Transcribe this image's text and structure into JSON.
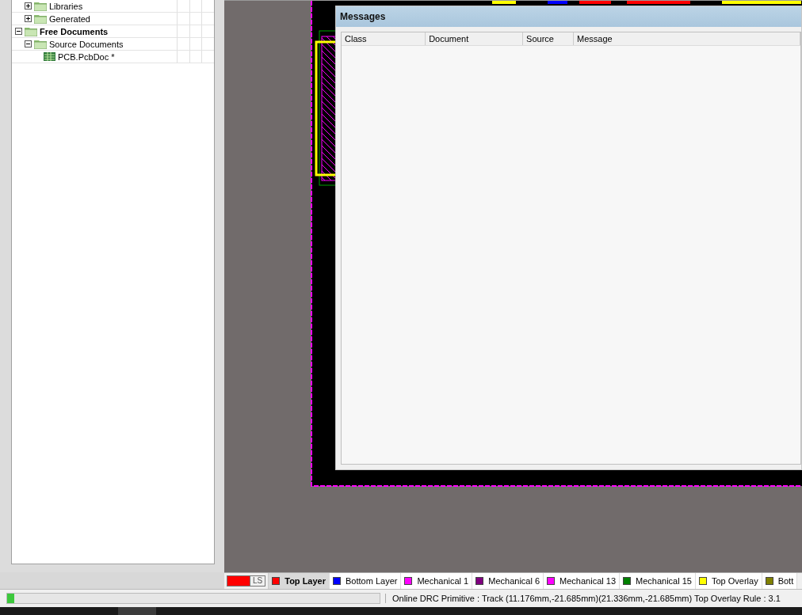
{
  "project_tree": {
    "items": [
      {
        "children": [
          {
            "label": "Libraries",
            "kind": "folder",
            "expanded": false,
            "bold": false
          },
          {
            "label": "Generated",
            "kind": "folder",
            "expanded": false,
            "bold": false
          }
        ]
      },
      {
        "label": "Free Documents",
        "kind": "folder",
        "expanded": true,
        "bold": true,
        "children": [
          {
            "label": "Source Documents",
            "kind": "folder",
            "expanded": true,
            "bold": false,
            "children": [
              {
                "label": "PCB.PcbDoc *",
                "kind": "document",
                "bold": false
              }
            ]
          }
        ]
      }
    ]
  },
  "messages_panel": {
    "title": "Messages",
    "columns": [
      "Class",
      "Document",
      "Source",
      "Message"
    ]
  },
  "layer_tabs": {
    "current_layer": {
      "color": "#ff0000",
      "label": "LS"
    },
    "tabs": [
      {
        "label": "Top Layer",
        "color": "#ff0000",
        "selected": true
      },
      {
        "label": "Bottom Layer",
        "color": "#0000ff",
        "selected": false
      },
      {
        "label": "Mechanical 1",
        "color": "#ff00ff",
        "selected": false
      },
      {
        "label": "Mechanical 6",
        "color": "#800080",
        "selected": false
      },
      {
        "label": "Mechanical 13",
        "color": "#ff00ff",
        "selected": false
      },
      {
        "label": "Mechanical 15",
        "color": "#008000",
        "selected": false
      },
      {
        "label": "Top Overlay",
        "color": "#ffff00",
        "selected": false
      },
      {
        "label": "Bott",
        "color": "#808000",
        "selected": false
      }
    ]
  },
  "status_bar": {
    "progress": {
      "level": 0.02
    },
    "text": "Online DRC Primitive : Track (11.176mm,-21.685mm)(21.336mm,-21.685mm)  Top Overlay Rule : 3.1"
  }
}
